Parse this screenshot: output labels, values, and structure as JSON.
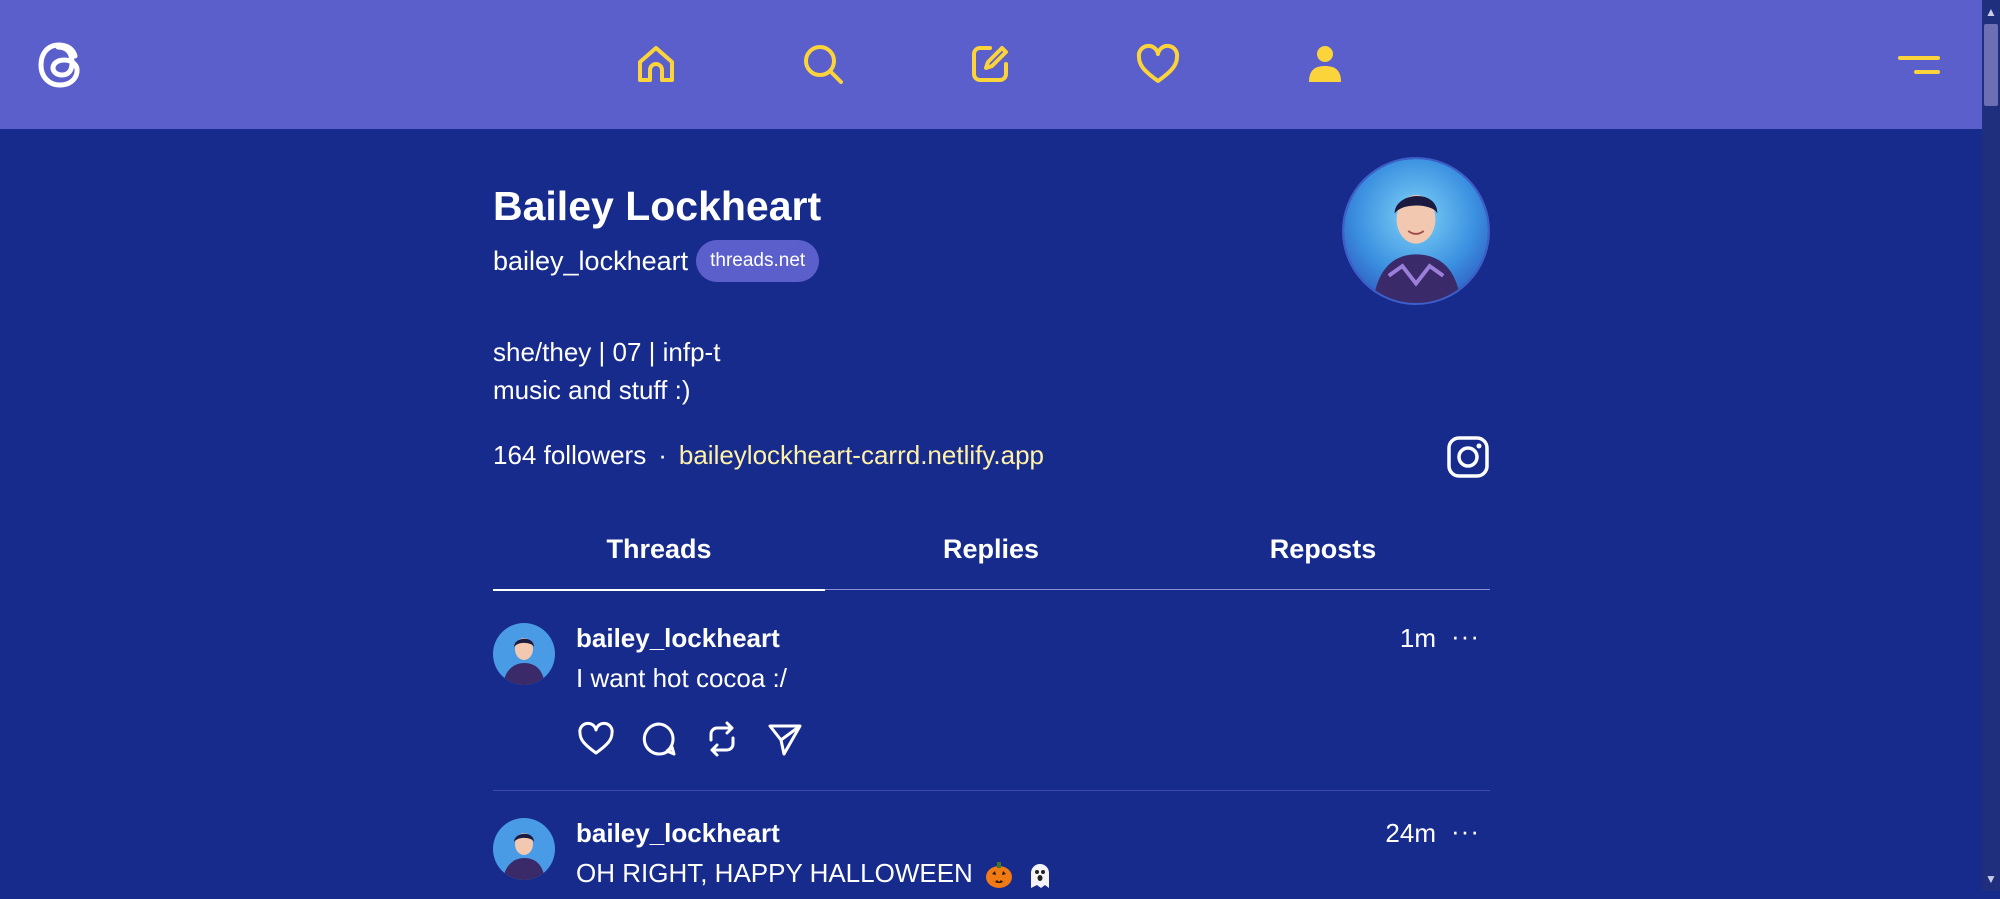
{
  "nav": {
    "icons": [
      "threads-logo-icon",
      "home-icon",
      "search-icon",
      "compose-icon",
      "heart-icon",
      "profile-icon",
      "menu-icon"
    ],
    "accent_color": "#fbd33a"
  },
  "profile": {
    "name": "Bailey Lockheart",
    "handle": "bailey_lockheart",
    "domain_badge": "threads.net",
    "bio_line1": "she/they | 07 | infp-t",
    "bio_line2": "music and stuff :)",
    "followers": "164 followers",
    "separator": "·",
    "link": "baileylockheart-carrd.netlify.app"
  },
  "tabs": [
    {
      "label": "Threads",
      "active": true
    },
    {
      "label": "Replies",
      "active": false
    },
    {
      "label": "Reposts",
      "active": false
    }
  ],
  "posts": [
    {
      "user": "bailey_lockheart",
      "time": "1m",
      "more": "···",
      "text": "I want hot cocoa :/"
    },
    {
      "user": "bailey_lockheart",
      "time": "24m",
      "more": "···",
      "text": "OH RIGHT, HAPPY HALLOWEEN"
    }
  ],
  "colors": {
    "background": "#172b8d",
    "topbar": "#5b5fcb",
    "link": "#fff2a8",
    "badge": "#5b5fcb"
  }
}
